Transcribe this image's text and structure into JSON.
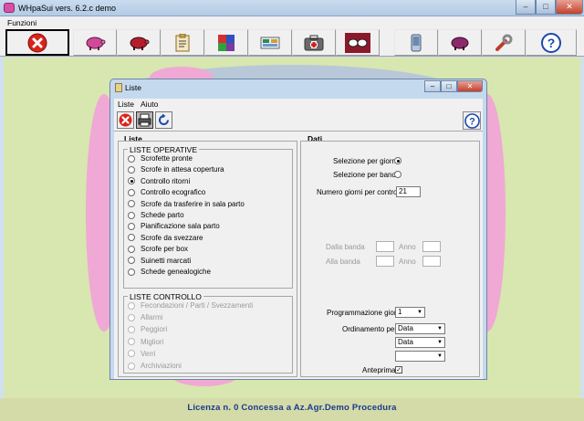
{
  "window": {
    "title": "WHpaSui  vers. 6.2.c  demo",
    "controls": {
      "minimize": "–",
      "maximize": "□",
      "close": "✕"
    }
  },
  "menubar": {
    "items": [
      "Funzioni"
    ]
  },
  "toolbar": {
    "buttons": [
      {
        "icon": "close-red-icon",
        "color": "#d9231b"
      },
      {
        "icon": "pig-icon",
        "color": "#d04a9a"
      },
      {
        "icon": "pig-red-icon",
        "color": "#b01e2e"
      },
      {
        "icon": "clipboard-icon",
        "color": "#c8a050"
      },
      {
        "icon": "cube-icon",
        "color": "#7a3aa0"
      },
      {
        "icon": "tools-icon",
        "color": "#2a8a5a"
      },
      {
        "icon": "first-aid-kit-icon",
        "color": "#555555"
      },
      {
        "icon": "glasses-icon",
        "color": "#8a1a2a"
      },
      {
        "icon": "phone-icon",
        "color": "#6a8ab0"
      },
      {
        "icon": "pig-purple-icon",
        "color": "#8a2a6a"
      },
      {
        "icon": "wrench-icon",
        "color": "#c03a2a"
      },
      {
        "icon": "help-icon",
        "color": "#1a4aa8"
      }
    ]
  },
  "dialog": {
    "title": "Liste",
    "controls": {
      "minimize": "–",
      "maximize": "□",
      "close": "✕"
    },
    "menu": [
      "Liste",
      "Aiuto"
    ],
    "liste": {
      "header": "Liste",
      "operative": {
        "title": "LISTE OPERATIVE",
        "selected": 2,
        "items": [
          "Scrofette pronte",
          "Scrofe in attesa copertura",
          "Controllo ritorni",
          "Controllo ecografico",
          "Scrofe da trasferire in sala parto",
          "Schede parto",
          "Pianificazione sala parto",
          "Scrofe da svezzare",
          "Scrofe per box",
          "Suinetti marcati",
          "Schede genealogiche"
        ]
      },
      "controllo": {
        "title": "LISTE CONTROLLO",
        "items": [
          "Fecondazioni / Parti / Svezzamenti",
          "Allarmi",
          "Peggiori",
          "Migliori",
          "Verri",
          "Archiviazioni"
        ]
      }
    },
    "dati": {
      "header": "Dati",
      "selezione_giorni": "Selezione per giorni",
      "selezione_banda": "Selezione per banda",
      "numero_giorni_label": "Numero giorni per controllo",
      "numero_giorni_value": "21",
      "dalla_banda": "Dalla banda",
      "alla_banda": "Alla banda",
      "anno": "Anno",
      "programmazione_label": "Programmazione giorni",
      "programmazione_value": "1",
      "ordinamento_label": "Ordinamento per",
      "ordinamento_1": "Data",
      "ordinamento_2": "Data",
      "ordinamento_3": "",
      "anteprima_label": "Anteprima",
      "anteprima_checked": true
    }
  },
  "status": {
    "license": "Licenza n. 0   Concessa a   Az.Agr.Demo Procedura"
  }
}
